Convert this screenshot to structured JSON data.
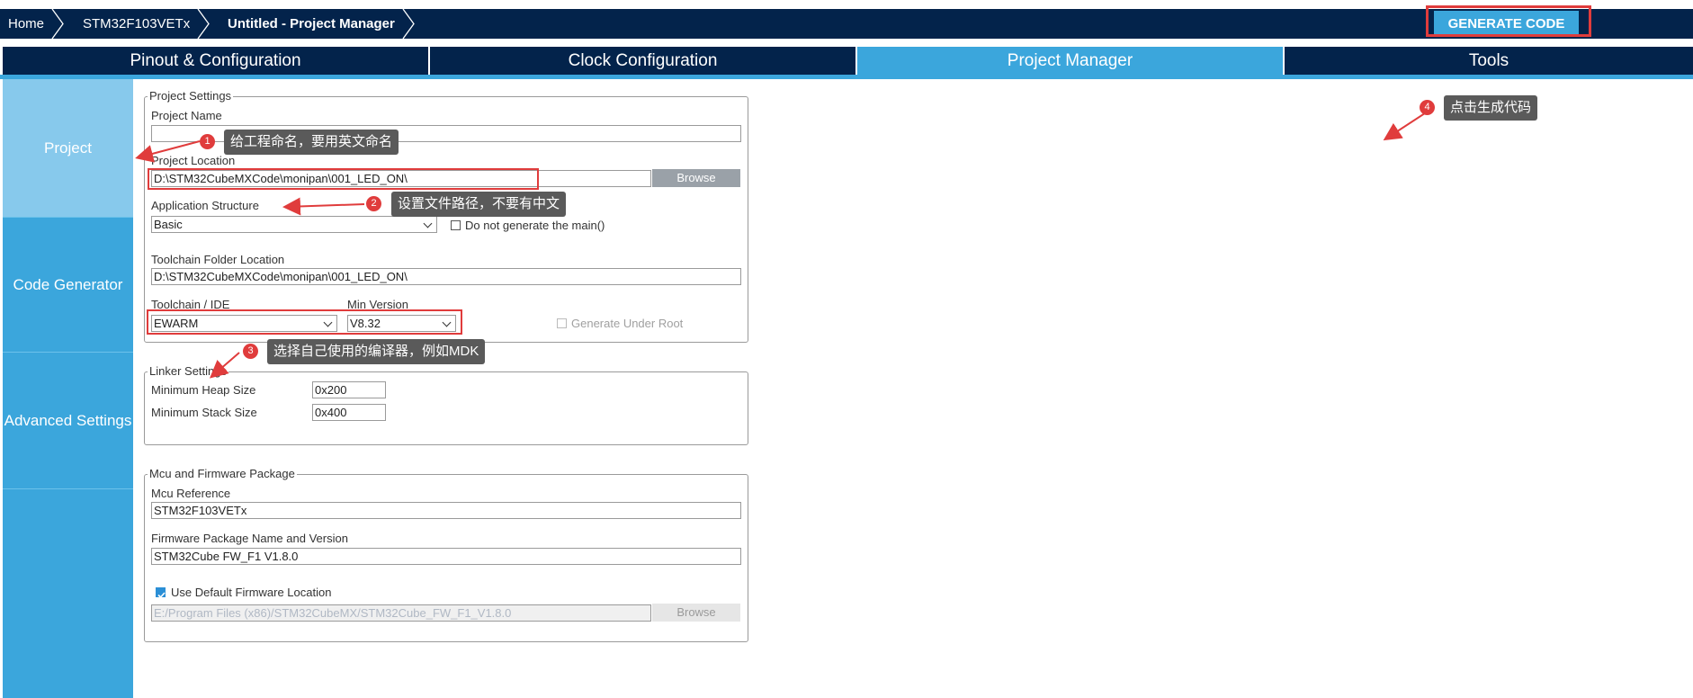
{
  "breadcrumb": [
    "Home",
    "STM32F103VETx",
    "Untitled - Project Manager"
  ],
  "generate_button": "GENERATE CODE",
  "tabs": [
    "Pinout & Configuration",
    "Clock Configuration",
    "Project Manager",
    "Tools"
  ],
  "sidenav": [
    "Project",
    "Code Generator",
    "Advanced Settings"
  ],
  "project_settings": {
    "legend": "Project Settings",
    "project_name_label": "Project Name",
    "project_name_value": "",
    "project_location_label": "Project Location",
    "project_location_value": "D:\\STM32CubeMXCode\\monipan\\001_LED_ON\\",
    "browse": "Browse",
    "app_structure_label": "Application Structure",
    "app_structure_value": "Basic",
    "no_main_label": "Do not generate the main()",
    "toolchain_folder_label": "Toolchain Folder Location",
    "toolchain_folder_value": "D:\\STM32CubeMXCode\\monipan\\001_LED_ON\\",
    "toolchain_ide_label": "Toolchain / IDE",
    "toolchain_ide_value": "EWARM",
    "min_version_label": "Min Version",
    "min_version_value": "V8.32",
    "generate_under_root_label": "Generate Under Root"
  },
  "linker_settings": {
    "legend": "Linker Settings",
    "heap_label": "Minimum Heap Size",
    "heap_value": "0x200",
    "stack_label": "Minimum Stack Size",
    "stack_value": "0x400"
  },
  "mcu_firmware": {
    "legend": "Mcu and Firmware Package",
    "mcu_reference_label": "Mcu Reference",
    "mcu_reference_value": "STM32F103VETx",
    "fw_label": "Firmware Package Name and Version",
    "fw_value": "STM32Cube FW_F1 V1.8.0",
    "use_default_label": "Use Default Firmware Location",
    "fw_path_value": "E:/Program Files (x86)/STM32CubeMX/STM32Cube_FW_F1_V1.8.0",
    "browse": "Browse"
  },
  "annotations": [
    {
      "num": "1",
      "text": "给工程命名，要用英文命名"
    },
    {
      "num": "2",
      "text": "设置文件路径，不要有中文"
    },
    {
      "num": "3",
      "text": "选择自己使用的编译器，例如MDK"
    },
    {
      "num": "4",
      "text": "点击生成代码"
    }
  ],
  "colors": {
    "navy": "#03234b",
    "accent": "#3ba6dc",
    "annotation_red": "#e03c3c"
  }
}
